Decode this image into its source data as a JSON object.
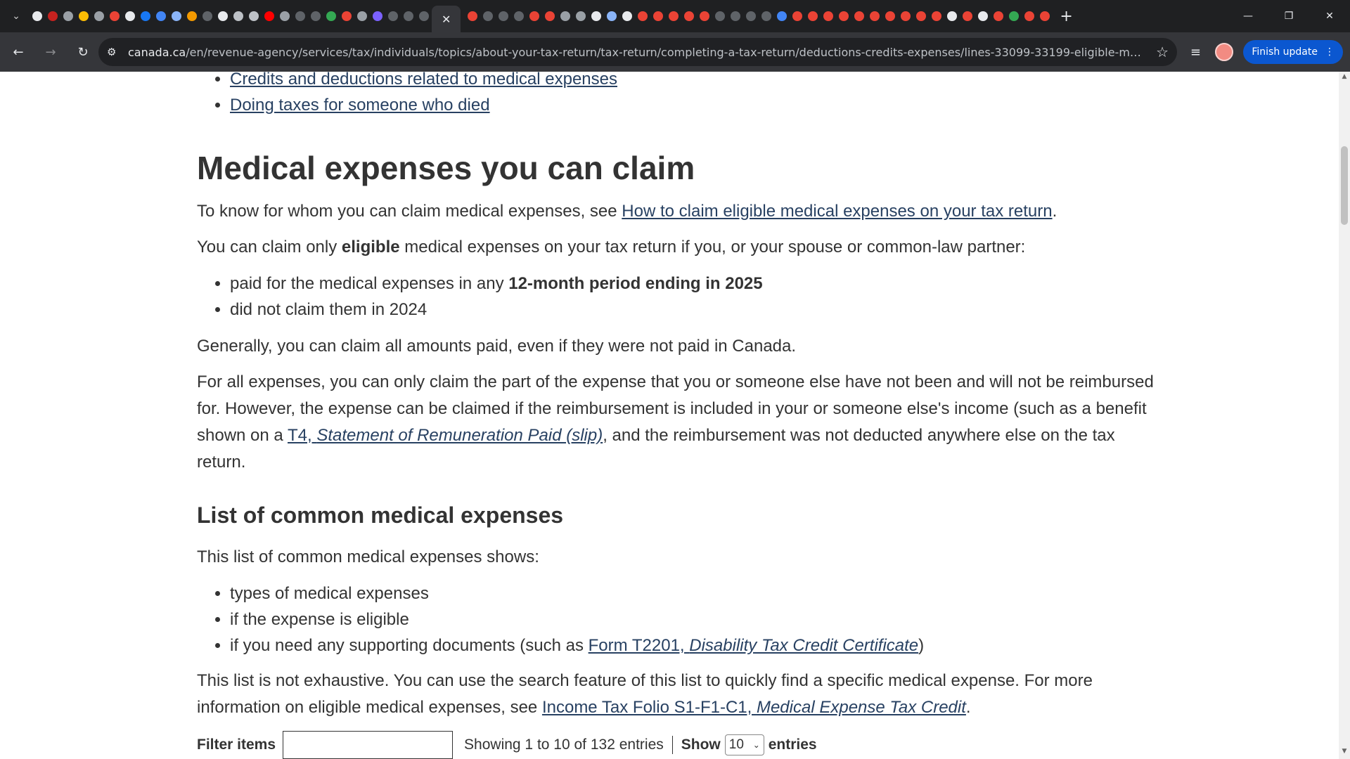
{
  "browser": {
    "url_host": "canada.ca",
    "url_path": "/en/revenue-agency/services/tax/individuals/topics/about-your-tax-return/tax-return/completing-a-tax-return/deductions-credits-expenses/lines-33099-33199-eligible-medical-expenses...",
    "finish_update_label": "Finish update",
    "colors": {
      "tabstrip": "#1f2022",
      "toolbar": "#35363a",
      "accent": "#0b57d0"
    }
  },
  "content": {
    "top_links": [
      "Credits and deductions related to medical expenses",
      "Doing taxes for someone who died"
    ],
    "heading": "Medical expenses you can claim",
    "intro_prefix": "To know for whom you can claim medical expenses, see ",
    "intro_link": "How to claim eligible medical expenses on your tax return",
    "intro_suffix": ".",
    "eligible_prefix": "You can claim only ",
    "eligible_bold": "eligible",
    "eligible_suffix": " medical expenses on your tax return if you, or your spouse or common-law partner:",
    "condition1_prefix": "paid for the medical expenses in any ",
    "condition1_bold": "12-month period ending in 2025",
    "condition2": "did not claim them in 2024",
    "generally": "Generally, you can claim all amounts paid, even if they were not paid in Canada.",
    "reimb_prefix": "For all expenses, you can only claim the part of the expense that you or someone else have not been and will not be reimbursed for. However, the expense can be claimed if the reimbursement is included in your or someone else's income (such as a benefit shown on a ",
    "reimb_link_plain": "T4, ",
    "reimb_link_italic": "Statement of Remuneration Paid (slip)",
    "reimb_suffix": ", and the reimbursement was not deducted anywhere else on the tax return.",
    "list_heading": "List of common medical expenses",
    "list_intro": "This list of common medical expenses shows:",
    "list_item1": "types of medical expenses",
    "list_item2": "if the expense is eligible",
    "list_item3_prefix": "if you need any supporting documents (such as ",
    "list_item3_link_plain": "Form T2201, ",
    "list_item3_link_italic": "Disability Tax Credit Certificate",
    "list_item3_suffix": ")",
    "exhaustive_prefix": "This list is not exhaustive. You can use the search feature of this list to quickly find a specific medical expense. For more information on eligible medical expenses, see ",
    "exhaustive_link_plain": "Income Tax Folio S1-F1-C1, ",
    "exhaustive_link_italic": "Medical Expense Tax Credit",
    "exhaustive_suffix": "."
  },
  "table_controls": {
    "filter_label": "Filter items",
    "filter_value": "",
    "showing_text": "Showing 1 to 10 of 132 entries",
    "show_label": "Show",
    "show_value": "10",
    "entries_label": "entries"
  }
}
